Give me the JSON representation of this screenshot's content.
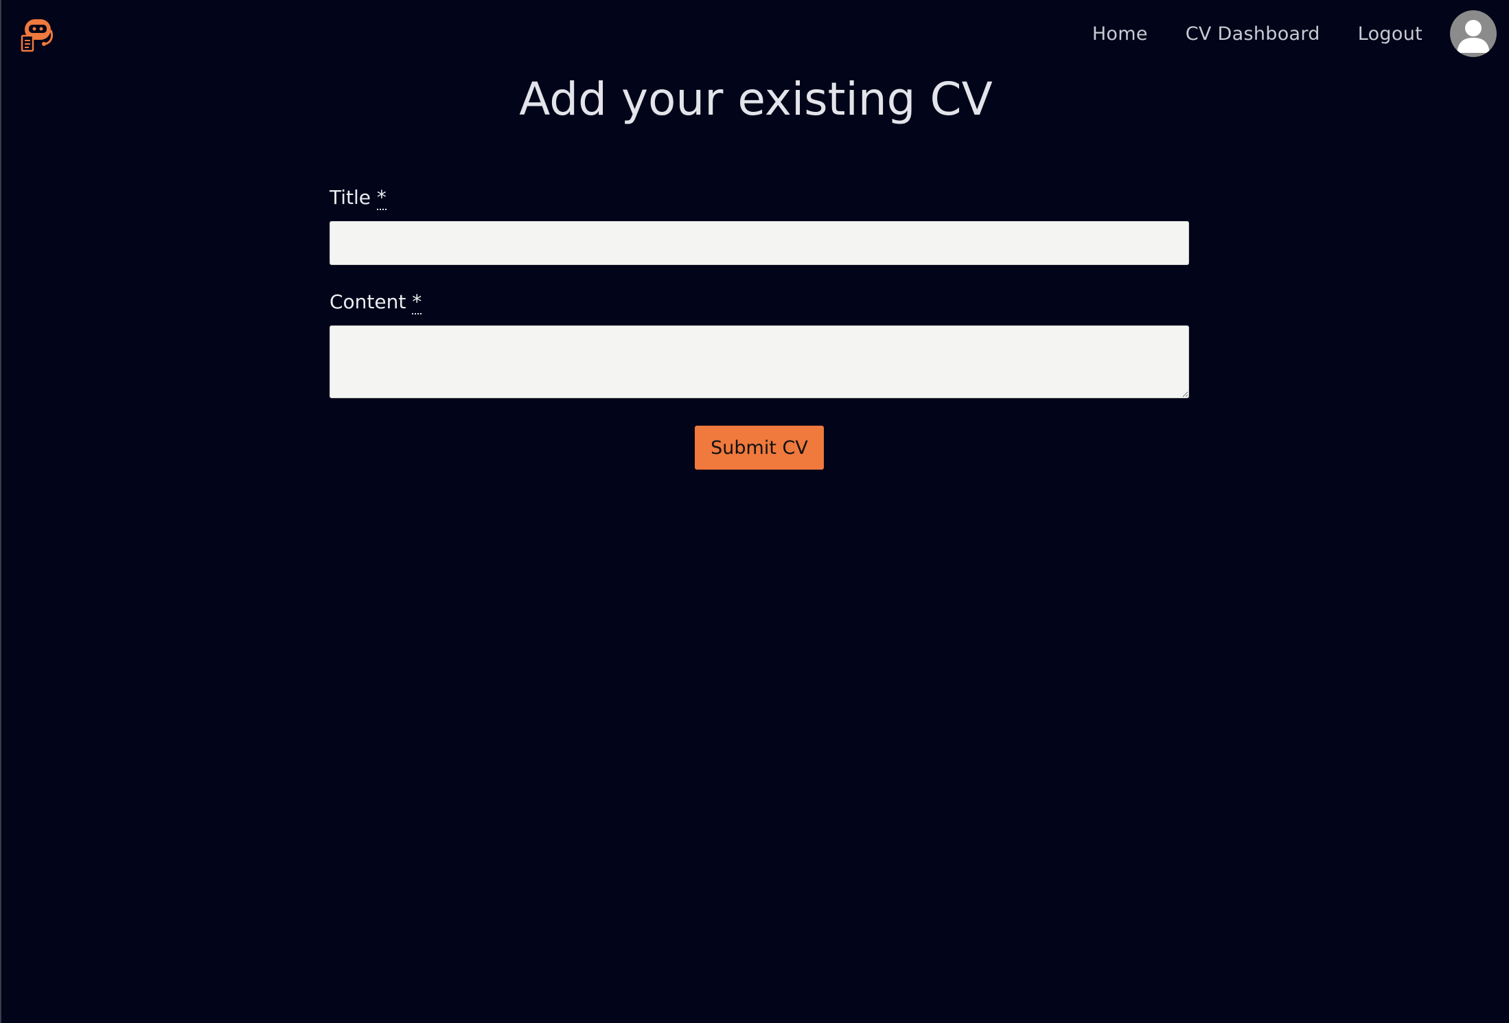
{
  "navbar": {
    "logo_icon": "robot-cv-logo-icon",
    "links": {
      "home": "Home",
      "cv_dashboard": "CV Dashboard",
      "logout": "Logout"
    },
    "avatar_icon": "user-avatar-icon"
  },
  "page": {
    "title": "Add your existing CV"
  },
  "form": {
    "title_label": "Title",
    "content_label": "Content",
    "required_marker": "*",
    "title_value": "",
    "content_value": "",
    "submit_label": "Submit CV"
  },
  "colors": {
    "background": "#020419",
    "accent": "#f0793d",
    "input_background": "#f4f4f3",
    "avatar": "#8b8b8b"
  }
}
